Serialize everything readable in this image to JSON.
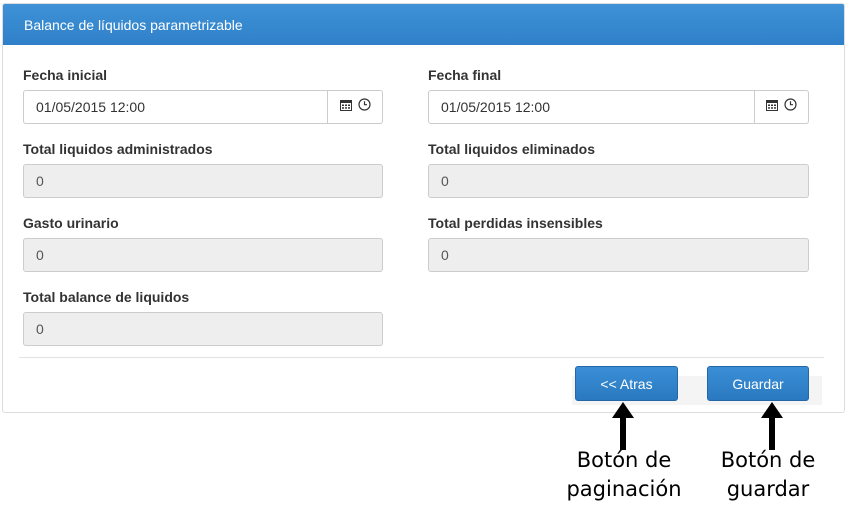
{
  "panel": {
    "title": "Balance de líquidos parametrizable"
  },
  "fields": {
    "fecha_inicial": {
      "label": "Fecha inicial",
      "value": "01/05/2015 12:00"
    },
    "fecha_final": {
      "label": "Fecha final",
      "value": "01/05/2015 12:00"
    },
    "total_administrados": {
      "label": "Total liquidos administrados",
      "value": "0"
    },
    "total_eliminados": {
      "label": "Total liquidos eliminados",
      "value": "0"
    },
    "gasto_urinario": {
      "label": "Gasto urinario",
      "value": "0"
    },
    "total_perdidas": {
      "label": "Total perdidas insensibles",
      "value": "0"
    },
    "total_balance": {
      "label": "Total balance de liquidos",
      "value": "0"
    }
  },
  "buttons": {
    "back_label": "<< Atras",
    "save_label": "Guardar"
  },
  "annotations": {
    "pagination_line1": "Botón de",
    "pagination_line2": "paginación",
    "save_line1": "Botón de",
    "save_line2": "guardar"
  },
  "icons": {
    "calendar": "calendar-icon",
    "clock": "clock-icon",
    "arrow": "arrow-up-icon"
  },
  "colors": {
    "header": "#3a8bd2",
    "button": "#2f82c8",
    "readonly_bg": "#eeeeee"
  }
}
